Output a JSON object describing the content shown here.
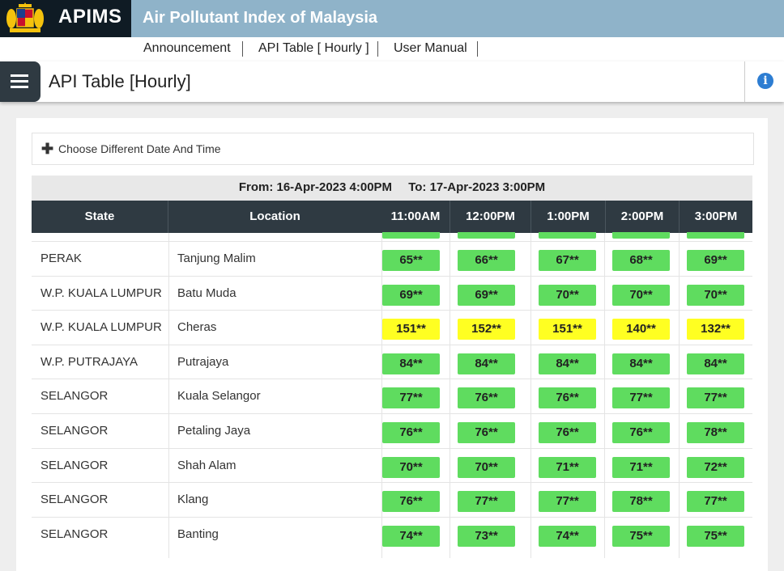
{
  "header": {
    "brand": "APIMS",
    "site_title": "Air Pollutant Index of Malaysia",
    "logo_icon": "malaysia-coat-of-arms-icon"
  },
  "nav": {
    "items": [
      "Announcement",
      "API Table [ Hourly ]",
      "User Manual"
    ]
  },
  "page": {
    "title": "API Table [Hourly]",
    "menu_icon": "hamburger-menu-icon",
    "info_icon": "info-icon"
  },
  "date_chooser": {
    "label": "Choose Different Date And Time",
    "icon": "plus-icon"
  },
  "range": {
    "from": "From: 16-Apr-2023  4:00PM",
    "to": "To: 17-Apr-2023  3:00PM"
  },
  "table": {
    "headers": {
      "state": "State",
      "location": "Location",
      "times": [
        "11:00AM",
        "12:00PM",
        "1:00PM",
        "2:00PM",
        "3:00PM"
      ]
    },
    "rows": [
      {
        "state": "PERAK",
        "location": "Tanjung Malim",
        "values": [
          "65**",
          "66**",
          "67**",
          "68**",
          "69**"
        ],
        "status": [
          "good",
          "good",
          "good",
          "good",
          "good"
        ]
      },
      {
        "state": "W.P. KUALA LUMPUR",
        "location": "Batu Muda",
        "values": [
          "69**",
          "69**",
          "70**",
          "70**",
          "70**"
        ],
        "status": [
          "good",
          "good",
          "good",
          "good",
          "good"
        ]
      },
      {
        "state": "W.P. KUALA LUMPUR",
        "location": "Cheras",
        "values": [
          "151**",
          "152**",
          "151**",
          "140**",
          "132**"
        ],
        "status": [
          "unhealthy",
          "unhealthy",
          "unhealthy",
          "unhealthy",
          "unhealthy"
        ]
      },
      {
        "state": "W.P. PUTRAJAYA",
        "location": "Putrajaya",
        "values": [
          "84**",
          "84**",
          "84**",
          "84**",
          "84**"
        ],
        "status": [
          "good",
          "good",
          "good",
          "good",
          "good"
        ]
      },
      {
        "state": "SELANGOR",
        "location": "Kuala Selangor",
        "values": [
          "77**",
          "76**",
          "76**",
          "77**",
          "77**"
        ],
        "status": [
          "good",
          "good",
          "good",
          "good",
          "good"
        ]
      },
      {
        "state": "SELANGOR",
        "location": "Petaling Jaya",
        "values": [
          "76**",
          "76**",
          "76**",
          "76**",
          "78**"
        ],
        "status": [
          "good",
          "good",
          "good",
          "good",
          "good"
        ]
      },
      {
        "state": "SELANGOR",
        "location": "Shah Alam",
        "values": [
          "70**",
          "70**",
          "71**",
          "71**",
          "72**"
        ],
        "status": [
          "good",
          "good",
          "good",
          "good",
          "good"
        ]
      },
      {
        "state": "SELANGOR",
        "location": "Klang",
        "values": [
          "76**",
          "77**",
          "77**",
          "78**",
          "77**"
        ],
        "status": [
          "good",
          "good",
          "good",
          "good",
          "good"
        ]
      },
      {
        "state": "SELANGOR",
        "location": "Banting",
        "values": [
          "74**",
          "73**",
          "74**",
          "75**",
          "75**"
        ],
        "status": [
          "good",
          "good",
          "good",
          "good",
          "good"
        ]
      }
    ]
  },
  "colors": {
    "good": "#5fdc5f",
    "unhealthy": "#ffff22",
    "header_bg": "#2f3a42",
    "topbar": "#8fb3c9"
  }
}
